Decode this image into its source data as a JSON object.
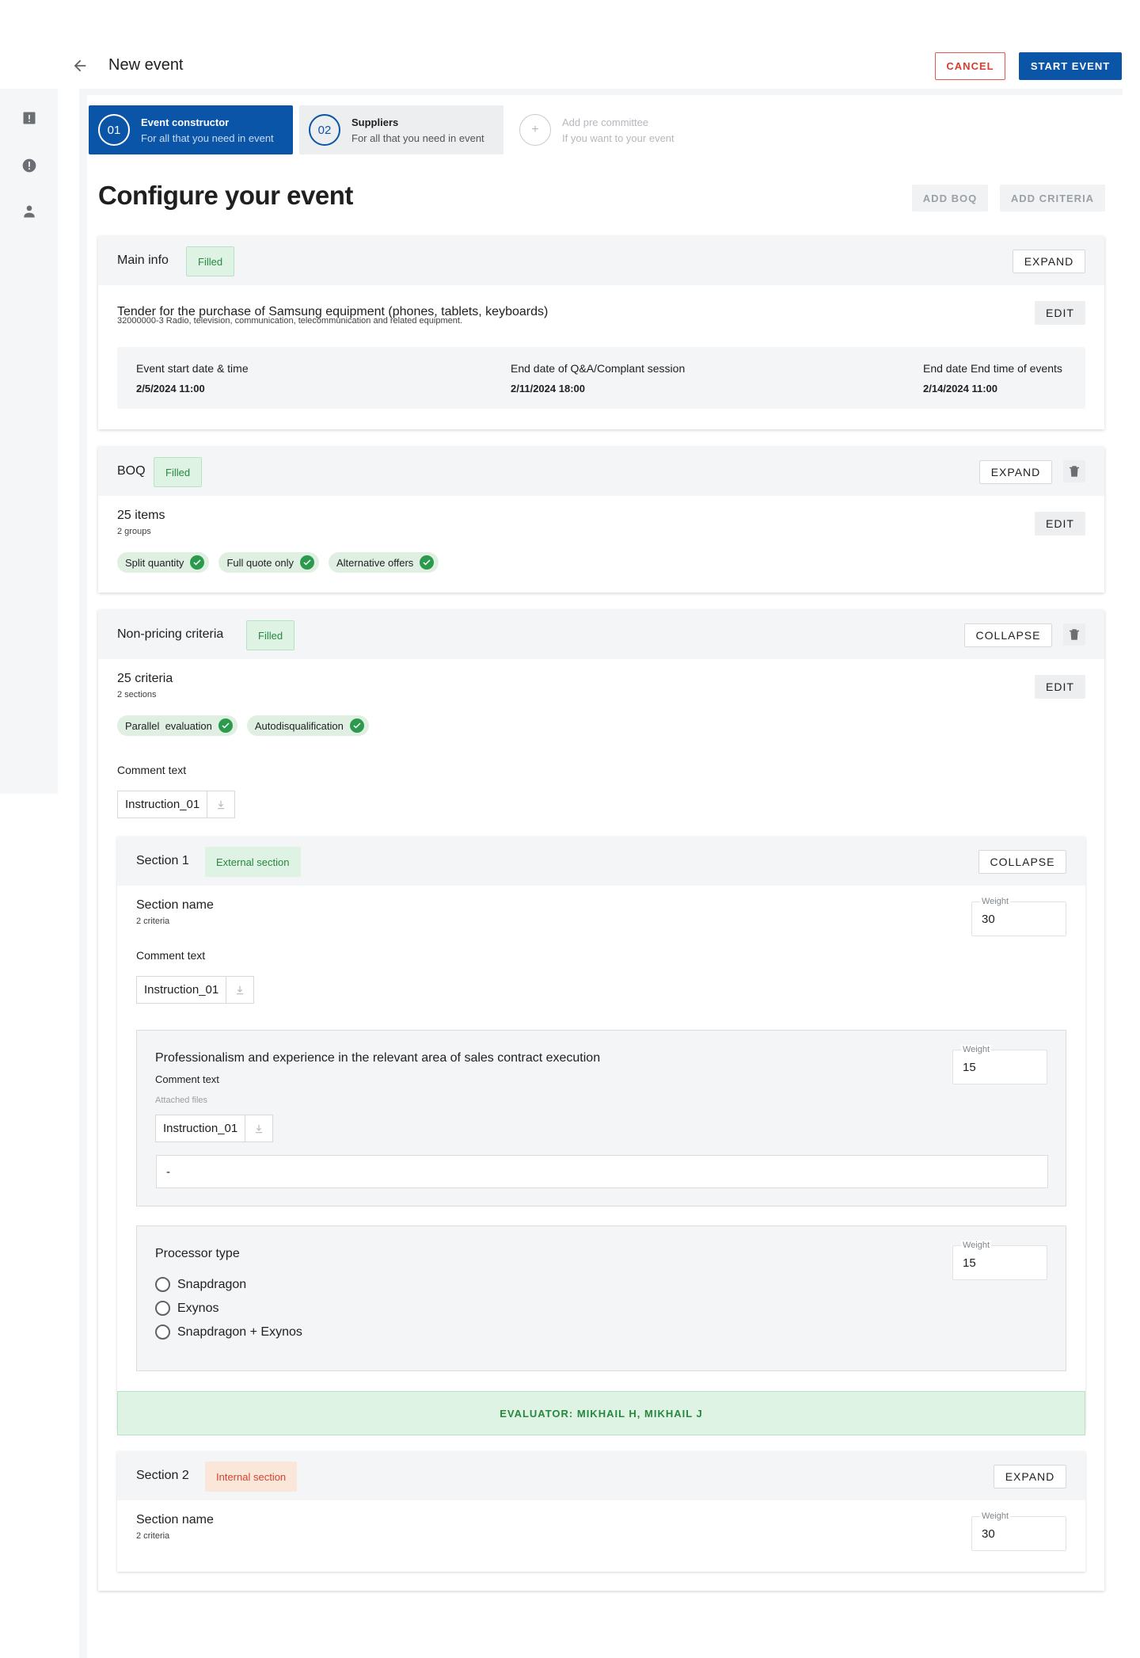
{
  "header": {
    "title": "New event",
    "cancel_label": "CANCEL",
    "start_label": "START EVENT"
  },
  "stepper": [
    {
      "num": "01",
      "title": "Event constructor",
      "subtitle": "For all that you need in event"
    },
    {
      "num": "02",
      "title": "Suppliers",
      "subtitle": "For all that you need in event"
    },
    {
      "num": "+",
      "title": "Add pre committee",
      "subtitle": "If you want to your event"
    }
  ],
  "page": {
    "title": "Configure your event",
    "add_boq_label": "ADD BOQ",
    "add_criteria_label": "ADD CRITERIA"
  },
  "main_info": {
    "title": "Main info",
    "badge": "Filled",
    "expand_label": "EXPAND",
    "edit_label": "EDIT",
    "tender_title": "Tender for the purchase of Samsung equipment (phones, tablets, keyboards)",
    "cpv": "32000000-3 Radio, television, communication, telecommunication and related equipment.",
    "dates": [
      {
        "label": "Event start date & time",
        "value": "2/5/2024 11:00"
      },
      {
        "label": "End date of Q&A/Complant session",
        "value": "2/11/2024 18:00"
      },
      {
        "label": "End date End time of events",
        "value": "2/14/2024 11:00"
      }
    ]
  },
  "boq": {
    "title": "BOQ",
    "badge": "Filled",
    "expand_label": "EXPAND",
    "edit_label": "EDIT",
    "items": "25 items",
    "groups": "2 groups",
    "chips": [
      "Split quantity",
      "Full quote only",
      "Alternative offers"
    ]
  },
  "npc": {
    "title": "Non-pricing criteria",
    "badge": "Filled",
    "collapse_label": "COLLAPSE",
    "edit_label": "EDIT",
    "criteria": "25 criteria",
    "sections": "2 sections",
    "chips": [
      "Parallel  evaluation",
      "Autodisqualification"
    ],
    "comment_label": "Comment text",
    "file_name": "Instruction_01"
  },
  "section1": {
    "title": "Section 1",
    "badge": "External section",
    "collapse_label": "COLLAPSE",
    "name": "Section name",
    "criteria_count": "2 criteria",
    "weight_label": "Weight",
    "weight": "30",
    "comment_label": "Comment text",
    "file_name": "Instruction_01",
    "criterion1": {
      "title": "Professionalism and experience in the relevant area of sales contract execution",
      "comment_label": "Comment text",
      "attached_label": "Attached files",
      "file_name": "Instruction_01",
      "answer": "-",
      "weight_label": "Weight",
      "weight": "15"
    },
    "criterion2": {
      "title": "Processor type",
      "weight_label": "Weight",
      "weight": "15",
      "options": [
        "Snapdragon",
        "Exynos",
        "Snapdragon + Exynos"
      ]
    },
    "evaluator": "EVALUATOR: MIKHAIL H, MIKHAIL J"
  },
  "section2": {
    "title": "Section 2",
    "badge": "Internal section",
    "expand_label": "EXPAND",
    "name": "Section name",
    "criteria_count": "2 criteria",
    "weight_label": "Weight",
    "weight": "30"
  },
  "colors": {
    "primary": "#0b55a8",
    "danger": "#d93c2f",
    "success": "#27873f",
    "success_bg": "#dff3e4",
    "warn_bg": "#fbe6da"
  },
  "icons": [
    "arrow-back-icon",
    "alert-square-icon",
    "alert-circle-icon",
    "person-icon",
    "trash-icon",
    "check-icon",
    "download-icon"
  ]
}
